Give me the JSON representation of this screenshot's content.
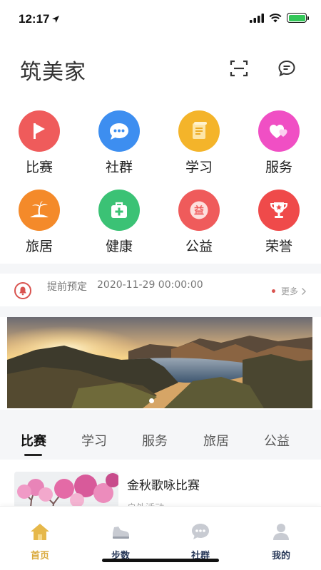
{
  "status_bar": {
    "time": "12:17"
  },
  "header": {
    "title": "筑美家"
  },
  "grid": [
    {
      "label": "比赛",
      "icon": "flag-play-icon",
      "color": "#ef5b5b"
    },
    {
      "label": "社群",
      "icon": "chat-bubble-icon",
      "color": "#3d8ef0"
    },
    {
      "label": "学习",
      "icon": "scroll-icon",
      "color": "#f4b42a"
    },
    {
      "label": "服务",
      "icon": "hearts-icon",
      "color": "#f04fc4"
    },
    {
      "label": "旅居",
      "icon": "palm-island-icon",
      "color": "#f48a2a"
    },
    {
      "label": "健康",
      "icon": "medical-kit-icon",
      "color": "#3bc275"
    },
    {
      "label": "公益",
      "icon": "charity-badge-icon",
      "color": "#ef5b5b"
    },
    {
      "label": "荣誉",
      "icon": "trophy-icon",
      "color": "#ef4a4a"
    }
  ],
  "notice": {
    "label": "提前预定",
    "date": "2020-11-29 00:00:00",
    "more": "更多"
  },
  "tabs": [
    {
      "label": "比赛",
      "active": true
    },
    {
      "label": "学习",
      "active": false
    },
    {
      "label": "服务",
      "active": false
    },
    {
      "label": "旅居",
      "active": false
    },
    {
      "label": "公益",
      "active": false
    }
  ],
  "card": {
    "title": "金秋歌咏比赛",
    "subtitle": "户外活动"
  },
  "bottom_nav": [
    {
      "label": "首页",
      "icon": "home-icon",
      "active": true
    },
    {
      "label": "步数",
      "icon": "sneaker-icon",
      "active": false
    },
    {
      "label": "社群",
      "icon": "chat-icon",
      "active": false
    },
    {
      "label": "我的",
      "icon": "user-icon",
      "active": false
    }
  ],
  "colors": {
    "accent": "#d9a93a",
    "alert": "#d9534f",
    "nav_text": "#2a3a5a"
  }
}
